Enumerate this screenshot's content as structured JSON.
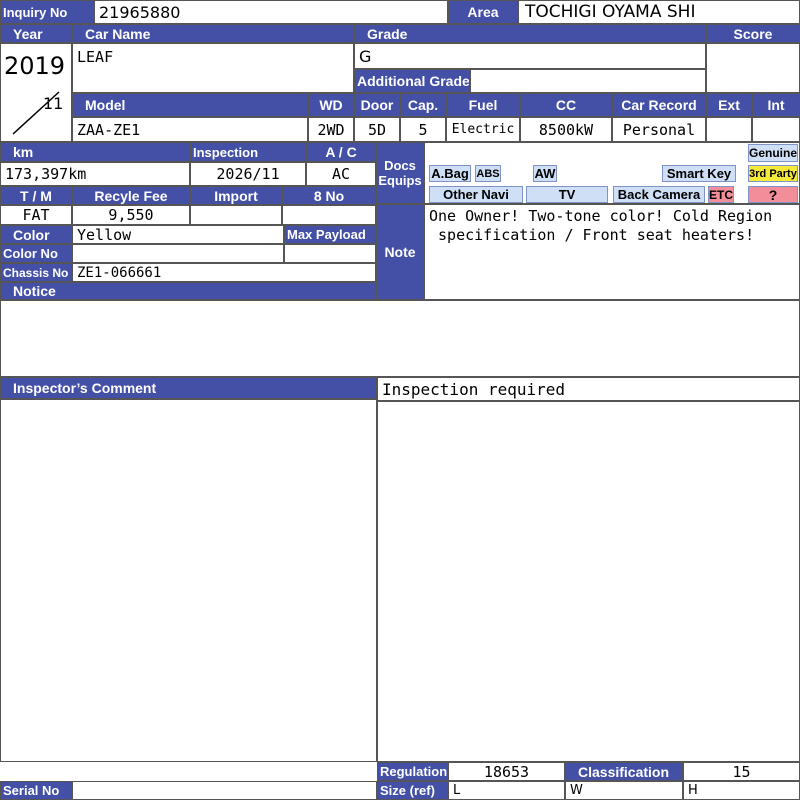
{
  "inquiry": {
    "label": "Inquiry No",
    "value": "21965880"
  },
  "area": {
    "label": "Area",
    "value": "TOCHIGI OYAMA SHI"
  },
  "year": {
    "label": "Year",
    "year": "2019",
    "month": "11"
  },
  "car_name": {
    "label": "Car Name",
    "value": "LEAF"
  },
  "grade": {
    "label": "Grade",
    "value": "G",
    "additional_label": "Additional Grade",
    "additional_value": ""
  },
  "score": {
    "label": "Score",
    "value": ""
  },
  "spec": {
    "model_label": "Model",
    "model": "ZAA-ZE1",
    "wd_label": "WD",
    "wd": "2WD",
    "door_label": "Door",
    "door": "5D",
    "cap_label": "Cap.",
    "cap": "5",
    "fuel_label": "Fuel",
    "fuel": "Electric",
    "cc_label": "CC",
    "cc": "8500kW",
    "record_label": "Car Record",
    "record": "Personal",
    "ext_label": "Ext",
    "ext": "",
    "int_label": "Int",
    "int": ""
  },
  "details": {
    "km_label": "km",
    "km": "173,397km",
    "inspection_label": "Inspection",
    "inspection": "2026/11",
    "ac_label": "A / C",
    "ac": "AC",
    "tm_label": "T / M",
    "tm": "FAT",
    "recycle_label": "Recyle Fee",
    "recycle": "9,550",
    "import_label": "Import",
    "import": "",
    "eight_label": "8 No",
    "eight": "",
    "color_label": "Color",
    "color": "Yellow",
    "max_payload_label": "Max Payload",
    "max_payload": "",
    "color_no_label": "Color No",
    "color_no": "",
    "chassis_label": "Chassis No",
    "chassis": "ZE1-066661",
    "notice_label": "Notice",
    "notice": ""
  },
  "docs": {
    "label_line1": "Docs",
    "label_line2": "Equips",
    "items": [
      "A.Bag",
      "ABS",
      "AW",
      "Smart Key",
      "Other Navi",
      "TV",
      "Back Camera",
      "ETC"
    ],
    "genuine": "Genuine",
    "third_party": "3rd Party",
    "unknown": "?"
  },
  "note": {
    "label": "Note",
    "text": "One Owner! Two-tone color! Cold Region\n specification / Front seat heaters!"
  },
  "inspector": {
    "label": "Inspector’s Comment",
    "text": "Inspection required"
  },
  "footer": {
    "regulation_label": "Regulation",
    "regulation": "18653",
    "classification_label": "Classification",
    "classification": "15",
    "size_label": "Size (ref)",
    "l_label": "L",
    "w_label": "W",
    "h_label": "H",
    "serial_label": "Serial No",
    "serial": ""
  },
  "colors": {
    "header": "#4350a6",
    "equip": "#cfe0f6",
    "etc": "#f28e9a",
    "third_party": "#f4ea3a"
  }
}
